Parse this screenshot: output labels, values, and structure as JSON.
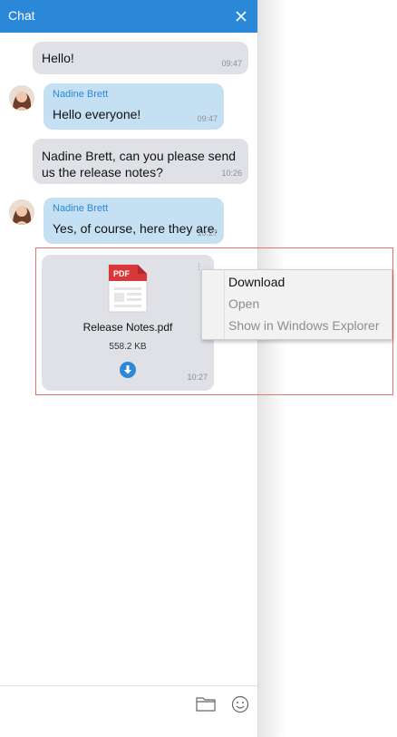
{
  "header": {
    "title": "Chat"
  },
  "messages": [
    {
      "text": "Hello!",
      "time": "09:47"
    },
    {
      "sender": "Nadine Brett",
      "text": "Hello everyone!",
      "time": "09:47"
    },
    {
      "line1": "Nadine Brett, can you please send",
      "line2": "us the release notes?",
      "time": "10:26"
    },
    {
      "sender": "Nadine Brett",
      "text": "Yes, of course, here they are.",
      "time": "10:27"
    }
  ],
  "file": {
    "icon_label": "PDF",
    "name": "Release Notes.pdf",
    "size": "558.2 KB",
    "time": "10:27",
    "more": "⋮"
  },
  "context_menu": {
    "items": [
      {
        "label": "Download"
      },
      {
        "label": "Open"
      },
      {
        "label": "Show in Windows Explorer"
      }
    ]
  },
  "composer": {
    "placeholder": ""
  },
  "colors": {
    "accent": "#2b88d8",
    "incoming": "#c6e0f3",
    "outgoing": "#dfe1e6",
    "pdf_red": "#d9383a",
    "selection": "#e57373"
  }
}
